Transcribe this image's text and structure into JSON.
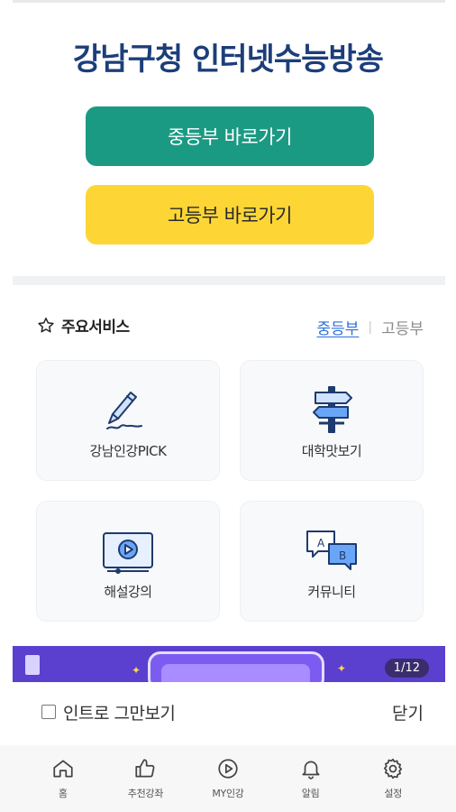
{
  "header": {
    "title": "강남구청 인터넷수능방송"
  },
  "buttons": {
    "middle_school": "중등부 바로가기",
    "high_school": "고등부 바로가기"
  },
  "services": {
    "title": "주요서비스",
    "tabs": [
      {
        "label": "중등부",
        "active": true
      },
      {
        "label": "고등부",
        "active": false
      }
    ],
    "tab_separator": "|",
    "cards": [
      {
        "label": "강남인강PICK",
        "icon": "pen-icon"
      },
      {
        "label": "대학맛보기",
        "icon": "signpost-icon"
      },
      {
        "label": "해설강의",
        "icon": "video-play-icon"
      },
      {
        "label": "커뮤니티",
        "icon": "chat-bubbles-icon"
      }
    ]
  },
  "banner": {
    "counter": "1/12"
  },
  "intro": {
    "checkbox_label": "인트로 그만보기",
    "close_label": "닫기"
  },
  "bottom_nav": [
    {
      "label": "홈",
      "icon": "home-icon"
    },
    {
      "label": "추천강좌",
      "icon": "thumbs-up-icon"
    },
    {
      "label": "MY인강",
      "icon": "play-circle-icon"
    },
    {
      "label": "알림",
      "icon": "bell-icon"
    },
    {
      "label": "설정",
      "icon": "gear-icon"
    }
  ],
  "colors": {
    "title": "#1c3e7a",
    "middle_button": "#1b9a83",
    "high_button": "#fdd635",
    "active_tab": "#2f6fd8",
    "banner": "#5b3fcf"
  }
}
